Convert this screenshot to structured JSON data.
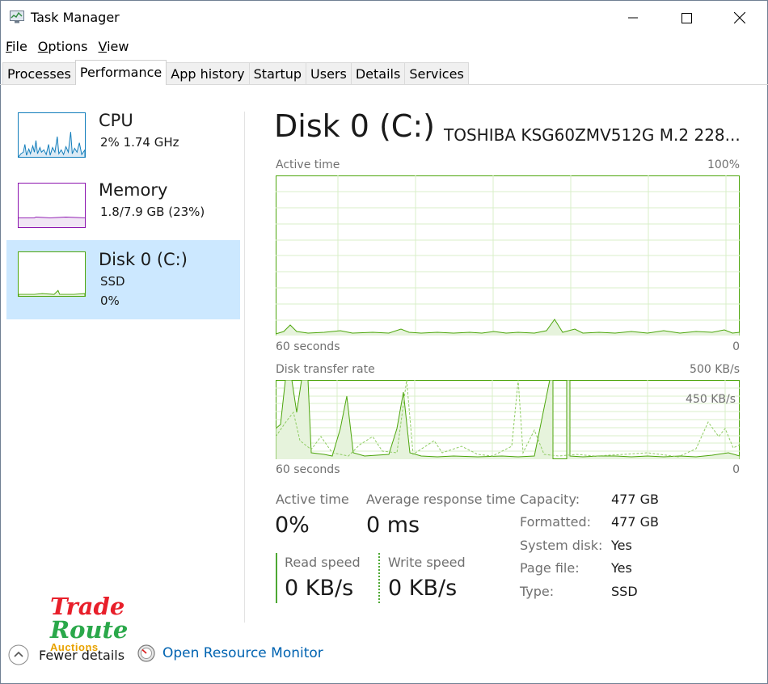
{
  "window": {
    "title": "Task Manager"
  },
  "menu": {
    "file": "File",
    "file_key": "F",
    "file_rest": "ile",
    "options_key": "O",
    "options_rest": "ptions",
    "view_key": "V",
    "view_rest": "iew"
  },
  "tabs": [
    {
      "label": "Processes"
    },
    {
      "label": "Performance"
    },
    {
      "label": "App history"
    },
    {
      "label": "Startup"
    },
    {
      "label": "Users"
    },
    {
      "label": "Details"
    },
    {
      "label": "Services"
    }
  ],
  "sidebar": {
    "cpu": {
      "title": "CPU",
      "sub": "2%  1.74 GHz",
      "color": "#117dbb"
    },
    "memory": {
      "title": "Memory",
      "sub": "1.8/7.9 GB (23%)",
      "color": "#8b12ae"
    },
    "disk": {
      "title": "Disk 0 (C:)",
      "type": "SSD",
      "usage": "0%",
      "color": "#4da60c"
    }
  },
  "main": {
    "title": "Disk 0 (C:)",
    "model": "TOSHIBA KSG60ZMV512G M.2 228...",
    "chart1": {
      "label": "Active time",
      "max": "100%",
      "time_left": "60 seconds",
      "time_right": "0"
    },
    "chart2": {
      "label": "Disk transfer rate",
      "max": "500 KB/s",
      "mid": "450 KB/s",
      "time_left": "60 seconds",
      "time_right": "0"
    },
    "stats": {
      "active_time_label": "Active time",
      "active_time_value": "0%",
      "avg_resp_label": "Average response time",
      "avg_resp_value": "0 ms",
      "read_label": "Read speed",
      "read_value": "0 KB/s",
      "write_label": "Write speed",
      "write_value": "0 KB/s"
    },
    "info": [
      {
        "label": "Capacity:",
        "value": "477 GB"
      },
      {
        "label": "Formatted:",
        "value": "477 GB"
      },
      {
        "label": "System disk:",
        "value": "Yes"
      },
      {
        "label": "Page file:",
        "value": "Yes"
      },
      {
        "label": "Type:",
        "value": "SSD"
      }
    ]
  },
  "footer": {
    "fewer_details": "Fewer details",
    "open_resource_monitor": "Open Resource Monitor"
  },
  "watermark": {
    "line1": "Trade",
    "line2": "Route",
    "line3": "Auctions"
  },
  "colors": {
    "accent_link": "#0063b1",
    "disk_green": "#4da60c",
    "selection": "#cce8ff"
  }
}
